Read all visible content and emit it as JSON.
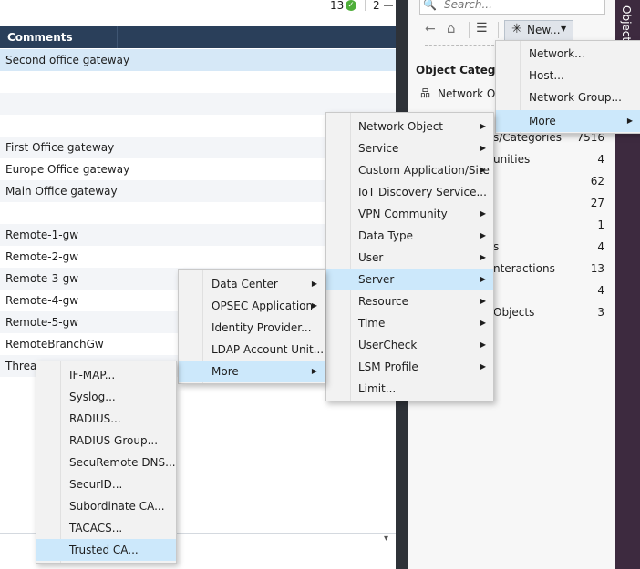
{
  "status": {
    "ok_count": "13",
    "other_count": "2"
  },
  "table": {
    "header": "Comments",
    "rows": [
      {
        "comment": "Second office gateway"
      },
      {
        "comment": ""
      },
      {
        "comment": ""
      },
      {
        "comment": ""
      },
      {
        "comment": "First Office gateway"
      },
      {
        "comment": "Europe Office gateway"
      },
      {
        "comment": "Main Office gateway"
      },
      {
        "comment": ""
      },
      {
        "comment": "Remote-1-gw"
      },
      {
        "comment": "Remote-2-gw"
      },
      {
        "comment": "Remote-3-gw"
      },
      {
        "comment": "Remote-4-gw"
      },
      {
        "comment": "Remote-5-gw"
      },
      {
        "comment": "RemoteBranchGw"
      },
      {
        "comment": "Threat"
      }
    ]
  },
  "right_panel": {
    "tab_label": "Objects",
    "search_placeholder": "Search...",
    "new_label": "New...",
    "category_title": "Object Categori",
    "categories": [
      {
        "label": "Network Obj",
        "count": ""
      },
      {
        "label": "",
        "count": ""
      },
      {
        "label": "s/Categories",
        "count": "7516"
      },
      {
        "label": "unities",
        "count": "4"
      },
      {
        "label": "",
        "count": "62"
      },
      {
        "label": "",
        "count": "27"
      },
      {
        "label": "",
        "count": "1"
      },
      {
        "label": "s",
        "count": "4"
      },
      {
        "label": "nteractions",
        "count": "13"
      },
      {
        "label": "",
        "count": "4"
      },
      {
        "label": "Objects",
        "count": "3"
      }
    ]
  },
  "new_menu": {
    "items": [
      "Network...",
      "Host...",
      "Network Group...",
      "More"
    ]
  },
  "more_menu": {
    "items": [
      "Network Object",
      "Service",
      "Custom Application/Site",
      "IoT Discovery Service...",
      "VPN Community",
      "Data Type",
      "User",
      "Server",
      "Resource",
      "Time",
      "UserCheck",
      "LSM Profile",
      "Limit..."
    ]
  },
  "server_menu": {
    "items": [
      "Data Center",
      "OPSEC Application",
      "Identity Provider...",
      "LDAP Account Unit...",
      "More"
    ]
  },
  "server_more_menu": {
    "items": [
      "IF-MAP...",
      "Syslog...",
      "RADIUS...",
      "RADIUS Group...",
      "SecuRemote DNS...",
      "SecurID...",
      "Subordinate CA...",
      "TACACS...",
      "Trusted CA..."
    ]
  },
  "colors": {
    "header": "#2a3f5a",
    "highlight": "#cce8fb",
    "ok": "#4fae3a",
    "dark_panel": "#2e3238",
    "objects_tab": "#3d2a3f"
  }
}
